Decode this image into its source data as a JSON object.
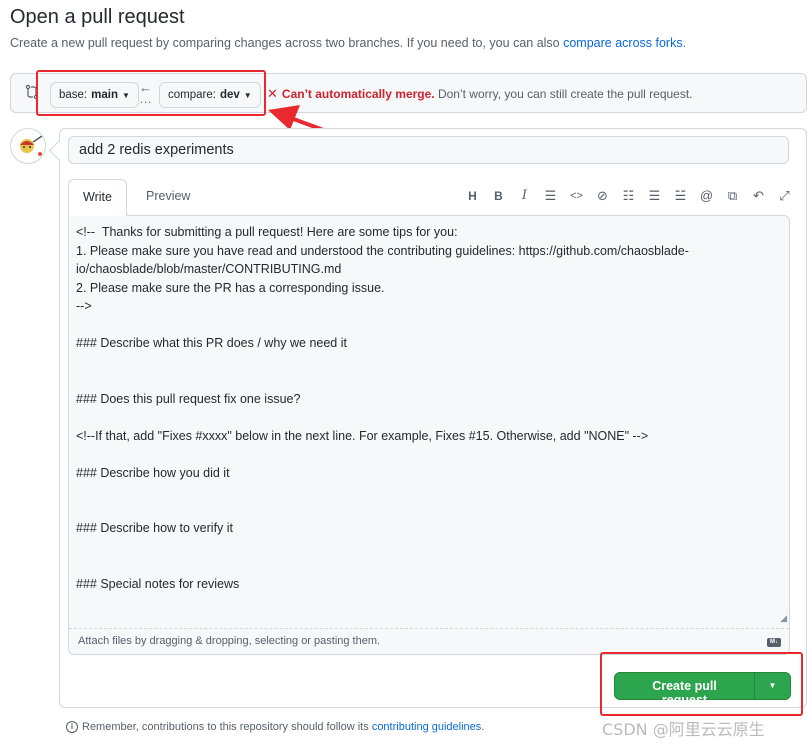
{
  "header": {
    "title": "Open a pull request",
    "subtitle_prefix": "Create a new pull request by comparing changes across two branches. If you need to, you can also ",
    "subtitle_link": "compare across forks",
    "subtitle_suffix": "."
  },
  "range": {
    "base_prefix": "base: ",
    "base_branch": "main",
    "compare_prefix": "compare: ",
    "compare_branch": "dev",
    "merge_status_error": "Can’t automatically merge.",
    "merge_status_note": " Don’t worry, you can still create the pull request."
  },
  "form": {
    "title_value": "add 2 redis experiments",
    "tabs": [
      {
        "label": "Write",
        "active": true
      },
      {
        "label": "Preview",
        "active": false
      }
    ],
    "toolbar_icons": [
      "heading-icon",
      "bold-icon",
      "italic-icon",
      "quote-icon",
      "code-icon",
      "link-icon",
      "bulleted-list-icon",
      "numbered-list-icon",
      "task-list-icon",
      "mention-icon",
      "reference-icon",
      "reply-icon",
      "fullscreen-icon"
    ],
    "body_text": "<!--  Thanks for submitting a pull request! Here are some tips for you:\n1. Please make sure you have read and understood the contributing guidelines: https://github.com/chaosblade-io/chaosblade/blob/master/CONTRIBUTING.md\n2. Please make sure the PR has a corresponding issue.\n-->\n\n### Describe what this PR does / why we need it\n\n\n### Does this pull request fix one issue?\n\n<!--If that, add \"Fixes #xxxx\" below in the next line. For example, Fixes #15. Otherwise, add \"NONE\" -->\n\n### Describe how you did it\n\n\n### Describe how to verify it\n\n\n### Special notes for reviews",
    "attach_hint": "Attach files by dragging & dropping, selecting or pasting them.",
    "markdown_badge": "M↓",
    "create_button_label": "Create pull request"
  },
  "footer": {
    "note_prefix": "Remember, contributions to this repository should follow its ",
    "note_link": "contributing guidelines",
    "note_suffix": "."
  },
  "watermark": "CSDN @阿里云云原生",
  "colors": {
    "link": "#0969da",
    "error": "#cf222e",
    "primary_button": "#2da44e",
    "annotation": "#e8292f"
  }
}
